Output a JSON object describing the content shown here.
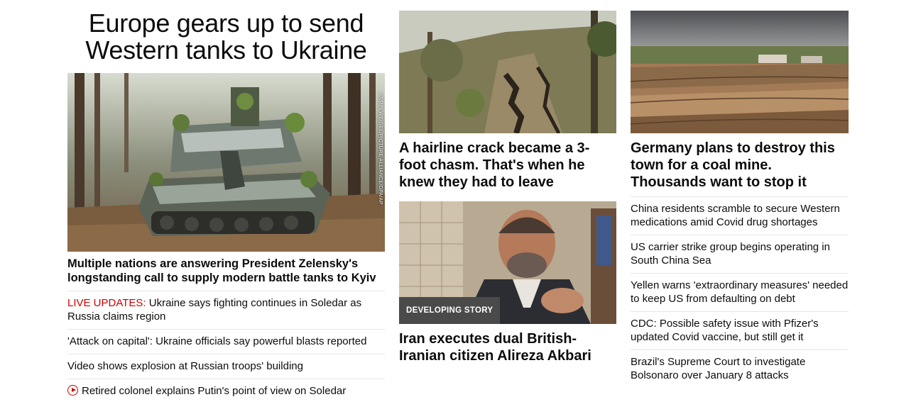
{
  "lead": {
    "title_line1": "Europe gears up to send",
    "title_line2": "Western tanks to Ukraine",
    "image_credit": "ARMIN WEIGEL/PICTURE ALLIANCE/DPA/AP",
    "subtitle": "Multiple nations are answering President Zelensky's longstanding call to supply modern battle tanks to Kyiv",
    "links": [
      {
        "prefix": "LIVE UPDATES:",
        "text": " Ukraine says fighting continues in Soledar as Russia claims region"
      },
      {
        "prefix": "",
        "text": "'Attack on capital': Ukraine officials say powerful blasts reported"
      },
      {
        "prefix": "",
        "text": "Video shows explosion at Russian troops' building"
      },
      {
        "prefix": "",
        "text": "Retired colonel explains Putin's point of view on Soledar",
        "icon": "play-icon"
      }
    ]
  },
  "middle": {
    "card1": {
      "title": "A hairline crack became a 3-foot chasm. That's when he knew they had to leave"
    },
    "card2": {
      "badge": "DEVELOPING STORY",
      "title": "Iran executes dual British-Iranian citizen Alireza Akbari"
    }
  },
  "right": {
    "card": {
      "title": "Germany plans to destroy this town for a coal mine. Thousands want to stop it"
    },
    "links": [
      "China residents scramble to secure Western medications amid Covid drug shortages",
      "US carrier strike group begins operating in South China Sea",
      "Yellen warns 'extraordinary measures' needed to keep US from defaulting on debt",
      "CDC: Possible safety issue with Pfizer's updated Covid vaccine, but still get it",
      "Brazil's Supreme Court to investigate Bolsonaro over January 8 attacks"
    ]
  },
  "colors": {
    "live": "#cc0000",
    "text": "#0c0c0c",
    "divider": "#e6e6e6",
    "badge": "#4a4a4a"
  }
}
